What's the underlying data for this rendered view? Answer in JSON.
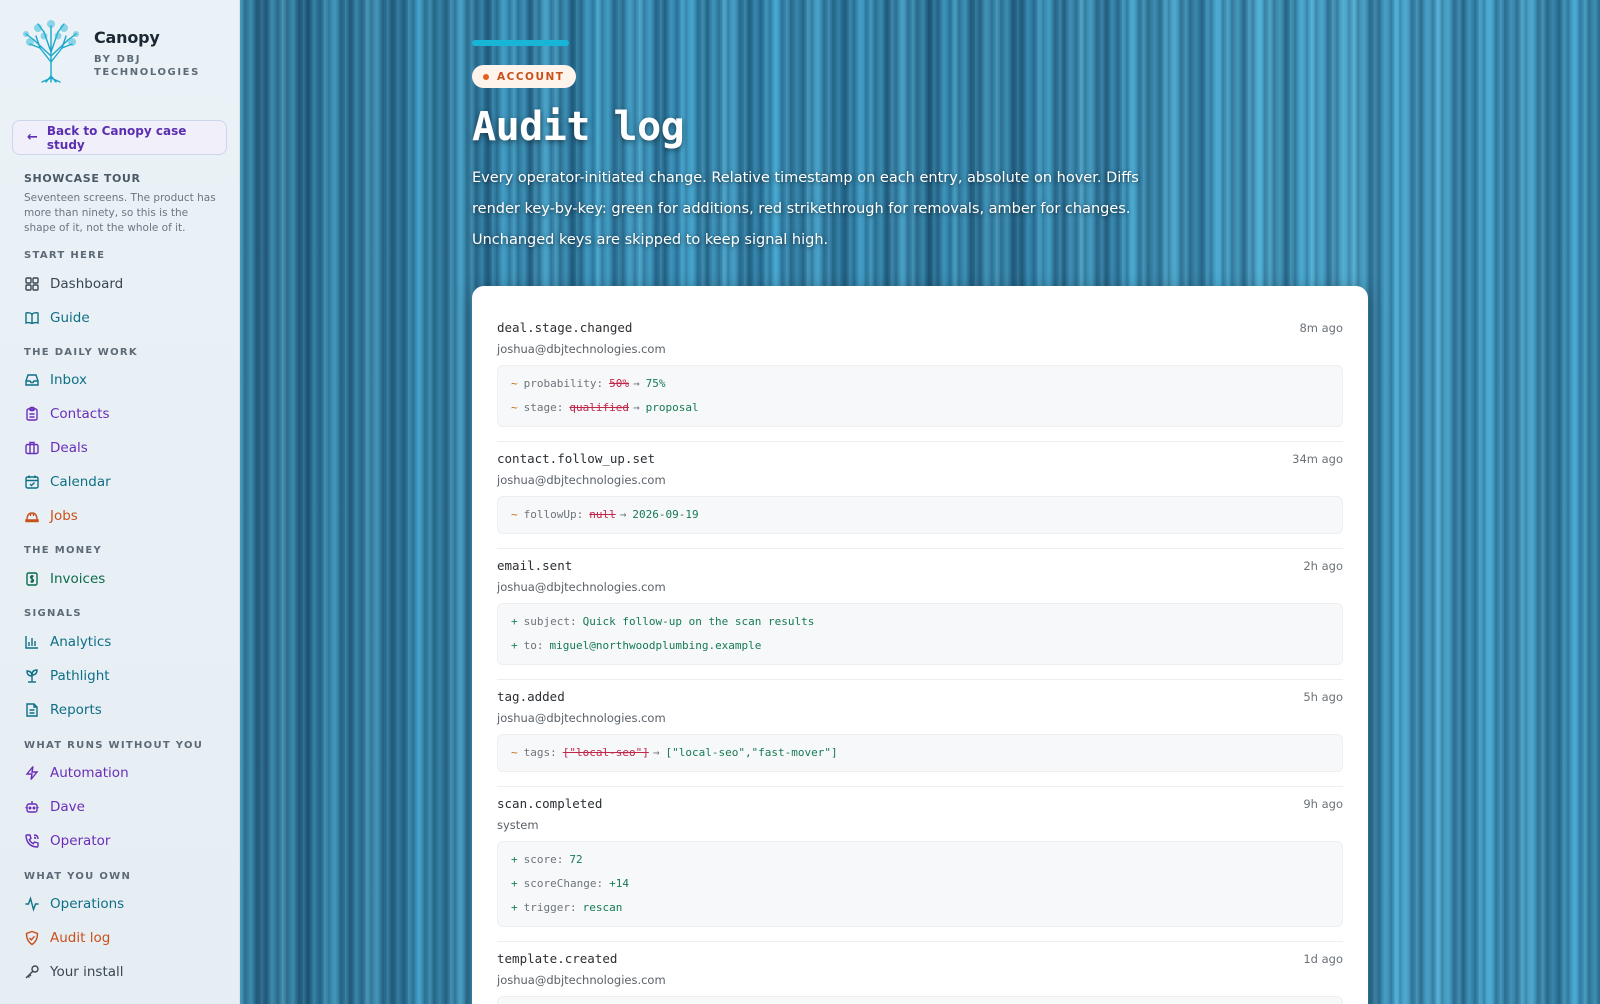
{
  "brand": {
    "name": "Canopy",
    "sub": "BY DBJ TECHNOLOGIES"
  },
  "back_label": "Back to Canopy case study",
  "tour": {
    "title": "SHOWCASE TOUR",
    "desc": "Seventeen screens. The product has more than ninety, so this is the shape of it, not the whole of it."
  },
  "nav": {
    "sections": [
      "START HERE",
      "THE DAILY WORK",
      "THE MONEY",
      "SIGNALS",
      "WHAT RUNS WITHOUT YOU",
      "WHAT YOU OWN"
    ],
    "items": [
      {
        "label": "Dashboard",
        "icon": "dashboard-icon"
      },
      {
        "label": "Guide",
        "icon": "book-icon"
      },
      {
        "label": "Inbox",
        "icon": "inbox-icon"
      },
      {
        "label": "Contacts",
        "icon": "clipboard-icon"
      },
      {
        "label": "Deals",
        "icon": "briefcase-icon"
      },
      {
        "label": "Calendar",
        "icon": "calendar-icon"
      },
      {
        "label": "Jobs",
        "icon": "hard-hat-icon"
      },
      {
        "label": "Invoices",
        "icon": "dollar-receipt-icon"
      },
      {
        "label": "Analytics",
        "icon": "bar-chart-icon"
      },
      {
        "label": "Pathlight",
        "icon": "sprout-icon"
      },
      {
        "label": "Reports",
        "icon": "file-text-icon"
      },
      {
        "label": "Automation",
        "icon": "lightning-icon"
      },
      {
        "label": "Dave",
        "icon": "robot-icon"
      },
      {
        "label": "Operator",
        "icon": "phone-icon"
      },
      {
        "label": "Operations",
        "icon": "activity-icon"
      },
      {
        "label": "Audit log",
        "icon": "shield-icon"
      },
      {
        "label": "Your install",
        "icon": "key-icon"
      }
    ]
  },
  "header": {
    "badge": "ACCOUNT",
    "title": "Audit log",
    "desc": "Every operator-initiated change. Relative timestamp on each entry, absolute on hover. Diffs render key-by-key: green for additions, red strikethrough for removals, amber for changes. Unchanged keys are skipped to keep signal high."
  },
  "entries": [
    {
      "event": "deal.stage.changed",
      "time": "8m ago",
      "actor": "joshua@dbjtechnologies.com",
      "diffs": [
        {
          "type": "change",
          "symbol": "~",
          "key": "probability:",
          "old": "50%",
          "arrow": "→",
          "new": "75%"
        },
        {
          "type": "change",
          "symbol": "~",
          "key": "stage:",
          "old": "qualified",
          "arrow": "→",
          "new": "proposal"
        }
      ]
    },
    {
      "event": "contact.follow_up.set",
      "time": "34m ago",
      "actor": "joshua@dbjtechnologies.com",
      "diffs": [
        {
          "type": "change",
          "symbol": "~",
          "key": "followUp:",
          "old": "null",
          "arrow": "→",
          "new": "2026-09-19"
        }
      ]
    },
    {
      "event": "email.sent",
      "time": "2h ago",
      "actor": "joshua@dbjtechnologies.com",
      "diffs": [
        {
          "type": "add",
          "symbol": "+",
          "key": "subject:",
          "value": "Quick follow-up on the scan results"
        },
        {
          "type": "add",
          "symbol": "+",
          "key": "to:",
          "value": "miguel@northwoodplumbing.example"
        }
      ]
    },
    {
      "event": "tag.added",
      "time": "5h ago",
      "actor": "joshua@dbjtechnologies.com",
      "diffs": [
        {
          "type": "change",
          "symbol": "~",
          "key": "tags:",
          "old": "[\"local-seo\"]",
          "arrow": "→",
          "new": "[\"local-seo\",\"fast-mover\"]"
        }
      ]
    },
    {
      "event": "scan.completed",
      "time": "9h ago",
      "actor": "system",
      "diffs": [
        {
          "type": "add",
          "symbol": "+",
          "key": "score:",
          "value": "72"
        },
        {
          "type": "add",
          "symbol": "+",
          "key": "scoreChange:",
          "value": "+14"
        },
        {
          "type": "add",
          "symbol": "+",
          "key": "trigger:",
          "value": "rescan"
        }
      ]
    },
    {
      "event": "template.created",
      "time": "1d ago",
      "actor": "joshua@dbjtechnologies.com",
      "diffs": []
    }
  ],
  "colors": {
    "accent": "#19b5d6",
    "add": "#157a53",
    "remove": "#c2264a",
    "change": "#c26b13",
    "badge": "#c9501b"
  }
}
